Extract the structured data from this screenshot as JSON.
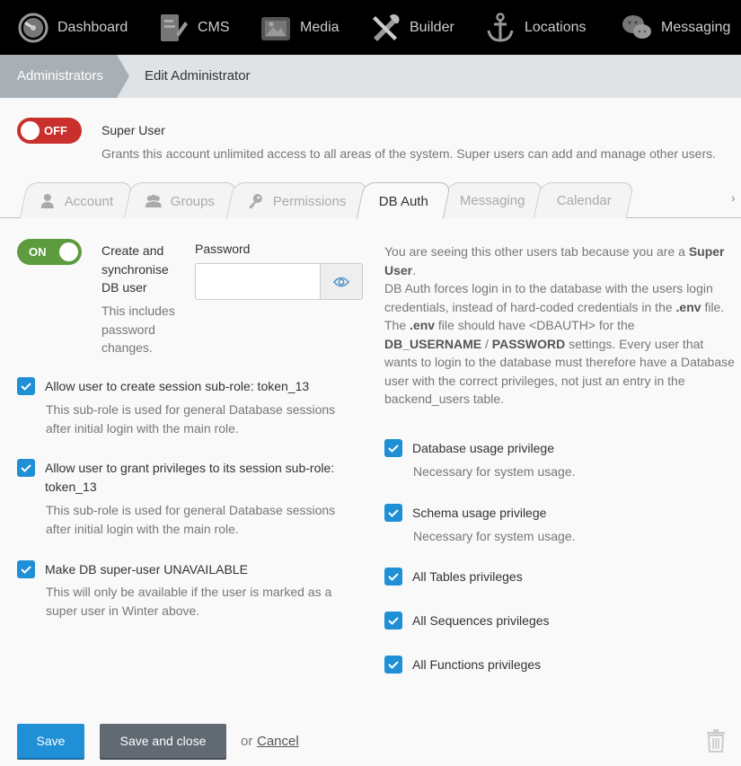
{
  "nav": {
    "items": [
      {
        "label": "Dashboard",
        "icon": "speedometer-icon"
      },
      {
        "label": "CMS",
        "icon": "cms-icon"
      },
      {
        "label": "Media",
        "icon": "media-icon"
      },
      {
        "label": "Builder",
        "icon": "tools-icon"
      },
      {
        "label": "Locations",
        "icon": "anchor-icon"
      },
      {
        "label": "Messaging",
        "icon": "chat-icon"
      }
    ]
  },
  "breadcrumb": {
    "parent": "Administrators",
    "current": "Edit Administrator"
  },
  "super_user": {
    "switch_label": "OFF",
    "title": "Super User",
    "description": "Grants this account unlimited access to all areas of the system. Super users can add and manage other users."
  },
  "tabs": [
    {
      "label": "Account",
      "icon": "user-icon"
    },
    {
      "label": "Groups",
      "icon": "users-icon"
    },
    {
      "label": "Permissions",
      "icon": "key-icon"
    },
    {
      "label": "DB Auth",
      "active": true
    },
    {
      "label": "Messaging"
    },
    {
      "label": "Calendar"
    }
  ],
  "tabs_more": "›",
  "db_auth": {
    "sync_switch_label": "ON",
    "sync_title": "Create and synchronise DB user",
    "sync_hint": "This includes password changes.",
    "password_label": "Password",
    "password_value": "",
    "options": [
      {
        "label": "Allow user to create session sub-role: token_13",
        "hint": "This sub-role is used for general Database sessions after initial login with the main role.",
        "checked": true
      },
      {
        "label": "Allow user to grant privileges to its session sub-role: token_13",
        "hint": "This sub-role is used for general Database sessions after initial login with the main role.",
        "checked": true
      },
      {
        "label": "Make DB super-user UNAVAILABLE",
        "hint": "This will only be available if the user is marked as a super user in Winter above.",
        "checked": true
      }
    ],
    "info": {
      "p1": "You are seeing this other users tab because you are a",
      "p1_bold": "Super User",
      "p2a": "DB Auth forces login in to the database with the users login credentials, instead of hard-coded credentials in the",
      "env1": ".env",
      "p2b": "file. The",
      "env2": ".env",
      "p2c": "file should have <DBAUTH> for the",
      "db_username": "DB_USERNAME",
      "slash": "/",
      "password_word": "PASSWORD",
      "p2d": "settings. Every user that wants to login to the database must therefore have a Database user with the correct privileges, not just an entry in the backend_users table."
    },
    "privileges": [
      {
        "label": "Database usage privilege",
        "hint": "Necessary for system usage.",
        "checked": true
      },
      {
        "label": "Schema usage privilege",
        "hint": "Necessary for system usage.",
        "checked": true
      },
      {
        "label": "All Tables privileges",
        "checked": true
      },
      {
        "label": "All Sequences privileges",
        "checked": true
      },
      {
        "label": "All Functions privileges",
        "checked": true
      }
    ]
  },
  "footer": {
    "save_label": "Save",
    "save_close_label": "Save and close",
    "or_text": "or",
    "cancel_label": "Cancel"
  },
  "colors": {
    "nav_bg": "#000000",
    "accent": "#1f8fd6",
    "switch_off": "#c9302c",
    "switch_on": "#5c9c3e"
  }
}
